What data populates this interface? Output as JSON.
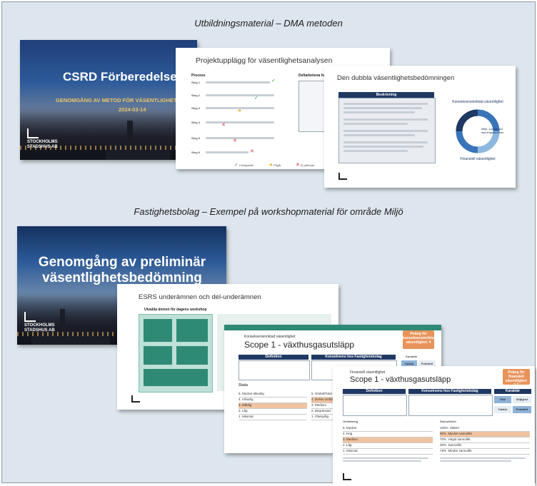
{
  "section1": {
    "caption": "Utbildningsmaterial – DMA metoden"
  },
  "section2": {
    "caption": "Fastighetsbolag – Exempel på workshopmaterial för område Miljö"
  },
  "slide1": {
    "title": "CSRD Förberedelser",
    "subtitle": "GENOMGÅNG AV METOD FÖR VÄSENTLIGHETS",
    "date": "2024-03-14",
    "logo_line1": "STOCKHOLMS",
    "logo_line2": "STADSHUS AB"
  },
  "slide2": {
    "title": "Projektupplägg för väsentlighetsanalysen",
    "left_heading": "Process",
    "right_heading": "Deltarbetena har detaljer",
    "steps": [
      {
        "label": "Steg 1",
        "status": "check"
      },
      {
        "label": "Steg 2",
        "status": "check"
      },
      {
        "label": "Steg 3",
        "status": "warn"
      },
      {
        "label": "Steg 4",
        "status": "x"
      },
      {
        "label": "Steg 5",
        "status": "x"
      },
      {
        "label": "Steg 6",
        "status": "x"
      }
    ],
    "legend": [
      "Färdigställt",
      "Pågår",
      "Ej påbörjat"
    ]
  },
  "slide3": {
    "title": "Den dubbla väsentlighetsbedömningen",
    "box_header": "Beskrivning",
    "diagram_top": "Konsekvensinriktad väsentlighet",
    "diagram_bottom": "Finansiell väsentlighet",
    "diagram_right": "Miljö, sociala och styrningsaspekter"
  },
  "slide4": {
    "title": "Genomgång av preliminär väsentlighetsbedömning",
    "logo_line1": "STOCKHOLMS",
    "logo_line2": "STADSHUS AB"
  },
  "slide5": {
    "title": "ESRS underämnen och del-underämnen",
    "subtitle": "Utvalda ämnen för dagens workshop"
  },
  "slide6": {
    "kicker": "Konsekvensinriktad väsentlighet",
    "title": "Scope 1 - växthusgasutsläpp",
    "badge": "Poäng för konsekvensinriktad väsentlighet: 4",
    "col_def": "Definition",
    "col_kons": "Konsekvens hos Fastighetsbolag",
    "col_karakt": "Karaktär",
    "karakt_left": "Faktisk",
    "karakt_right": "Potentiell",
    "scale_header": "Skala",
    "scale_rows": [
      "5. Mycket allvarlig",
      "4. Allvarlig",
      "3. Måttlig",
      "2. Låg",
      "1. Minimal"
    ],
    "cat_rows": [
      "5. Global/Total",
      "4. Delvis omfattande",
      "3. Medium",
      "2. Begränsad",
      "1. Obetydlig"
    ]
  },
  "slide7": {
    "kicker": "Finansiell väsentlighet",
    "title": "Scope 1 - växthusgasutsläpp",
    "badge": "Poäng för finansiell väsentlighet: 3,7",
    "col_def": "Definition",
    "col_kons": "Konsekvens hos Fastighetsbolag",
    "col_karakt": "Karaktär",
    "karakt": [
      "Risk",
      "Möjlighet",
      "Faktisk",
      "Potentiell"
    ],
    "scale_header": "Omfattning",
    "prob_header": "Sannolikhet",
    "scale_rows": [
      "5. Mycket",
      "4. Hög",
      "3. Medium",
      "2. Låg",
      "1. Minimal"
    ],
    "prob_rows": [
      {
        "pct": "100%",
        "label": "Säkert"
      },
      {
        "pct": "80%",
        "label": "Mycket sannolikt"
      },
      {
        "pct": "70%",
        "label": "Högst sannolikt"
      },
      {
        "pct": "30%",
        "label": "Sannolikt"
      },
      {
        "pct": "<5%",
        "label": "Mindre sannolikt"
      }
    ]
  }
}
